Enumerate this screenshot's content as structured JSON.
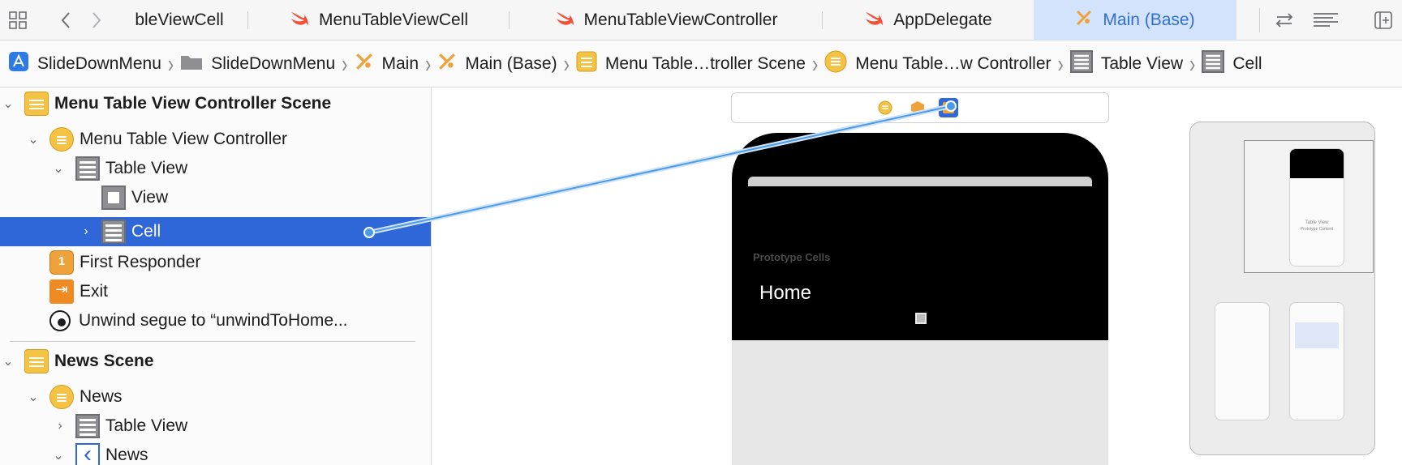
{
  "tabs": [
    {
      "label": "bleViewCell",
      "icon": "",
      "active": false
    },
    {
      "label": "MenuTableViewCell",
      "icon": "swift-icon",
      "active": false
    },
    {
      "label": "MenuTableViewController",
      "icon": "swift-icon",
      "active": false
    },
    {
      "label": "AppDelegate",
      "icon": "swift-icon",
      "active": false
    },
    {
      "label": "Main (Base)",
      "icon": "storyboard-icon",
      "active": true
    }
  ],
  "breadcrumb": [
    {
      "label": "SlideDownMenu",
      "icon": "app-project-icon"
    },
    {
      "label": "SlideDownMenu",
      "icon": "folder-icon"
    },
    {
      "label": "Main",
      "icon": "storyboard-icon"
    },
    {
      "label": "Main (Base)",
      "icon": "storyboard-icon"
    },
    {
      "label": "Menu Table…troller Scene",
      "icon": "scene-icon"
    },
    {
      "label": "Menu Table…w Controller",
      "icon": "view-controller-icon"
    },
    {
      "label": "Table View",
      "icon": "table-view-icon"
    },
    {
      "label": "Cell",
      "icon": "table-view-icon"
    }
  ],
  "outline": {
    "rows": [
      {
        "label": "Menu Table View Controller Scene",
        "icon": "scene-icon",
        "disclosure": "open",
        "bold": true
      },
      {
        "label": "Menu Table View Controller",
        "icon": "view-controller-icon",
        "disclosure": "open",
        "bold": false
      },
      {
        "label": "Table View",
        "icon": "table-view-icon",
        "disclosure": "open",
        "bold": false
      },
      {
        "label": "View",
        "icon": "view-icon",
        "disclosure": "none",
        "bold": false
      },
      {
        "label": "Cell",
        "icon": "table-cell-icon",
        "disclosure": "closed",
        "bold": false,
        "selected": true
      },
      {
        "label": "First Responder",
        "icon": "first-responder-icon",
        "disclosure": "none",
        "bold": false
      },
      {
        "label": "Exit",
        "icon": "exit-icon",
        "disclosure": "none",
        "bold": false
      },
      {
        "label": "Unwind segue to “unwindToHome...",
        "icon": "unwind-segue-icon",
        "disclosure": "none",
        "bold": false
      },
      {
        "label": "News Scene",
        "icon": "scene-icon",
        "disclosure": "open",
        "bold": true
      },
      {
        "label": "News",
        "icon": "view-controller-icon",
        "disclosure": "open",
        "bold": false
      },
      {
        "label": "Table View",
        "icon": "table-view-icon",
        "disclosure": "closed",
        "bold": false
      },
      {
        "label": "News",
        "icon": "navigation-item-icon",
        "disclosure": "open",
        "bold": false
      }
    ]
  },
  "canvas": {
    "prototype_label": "Prototype Cells",
    "cell_text": "Home",
    "minimap_thumb_label": "Table View",
    "minimap_thumb_sub": "Prototype Content"
  },
  "colors": {
    "accent": "#2f67d8",
    "active_tab_bg": "#d3e3fb",
    "scene_yellow": "#f5c343",
    "connector_blue": "#4a9be8"
  }
}
